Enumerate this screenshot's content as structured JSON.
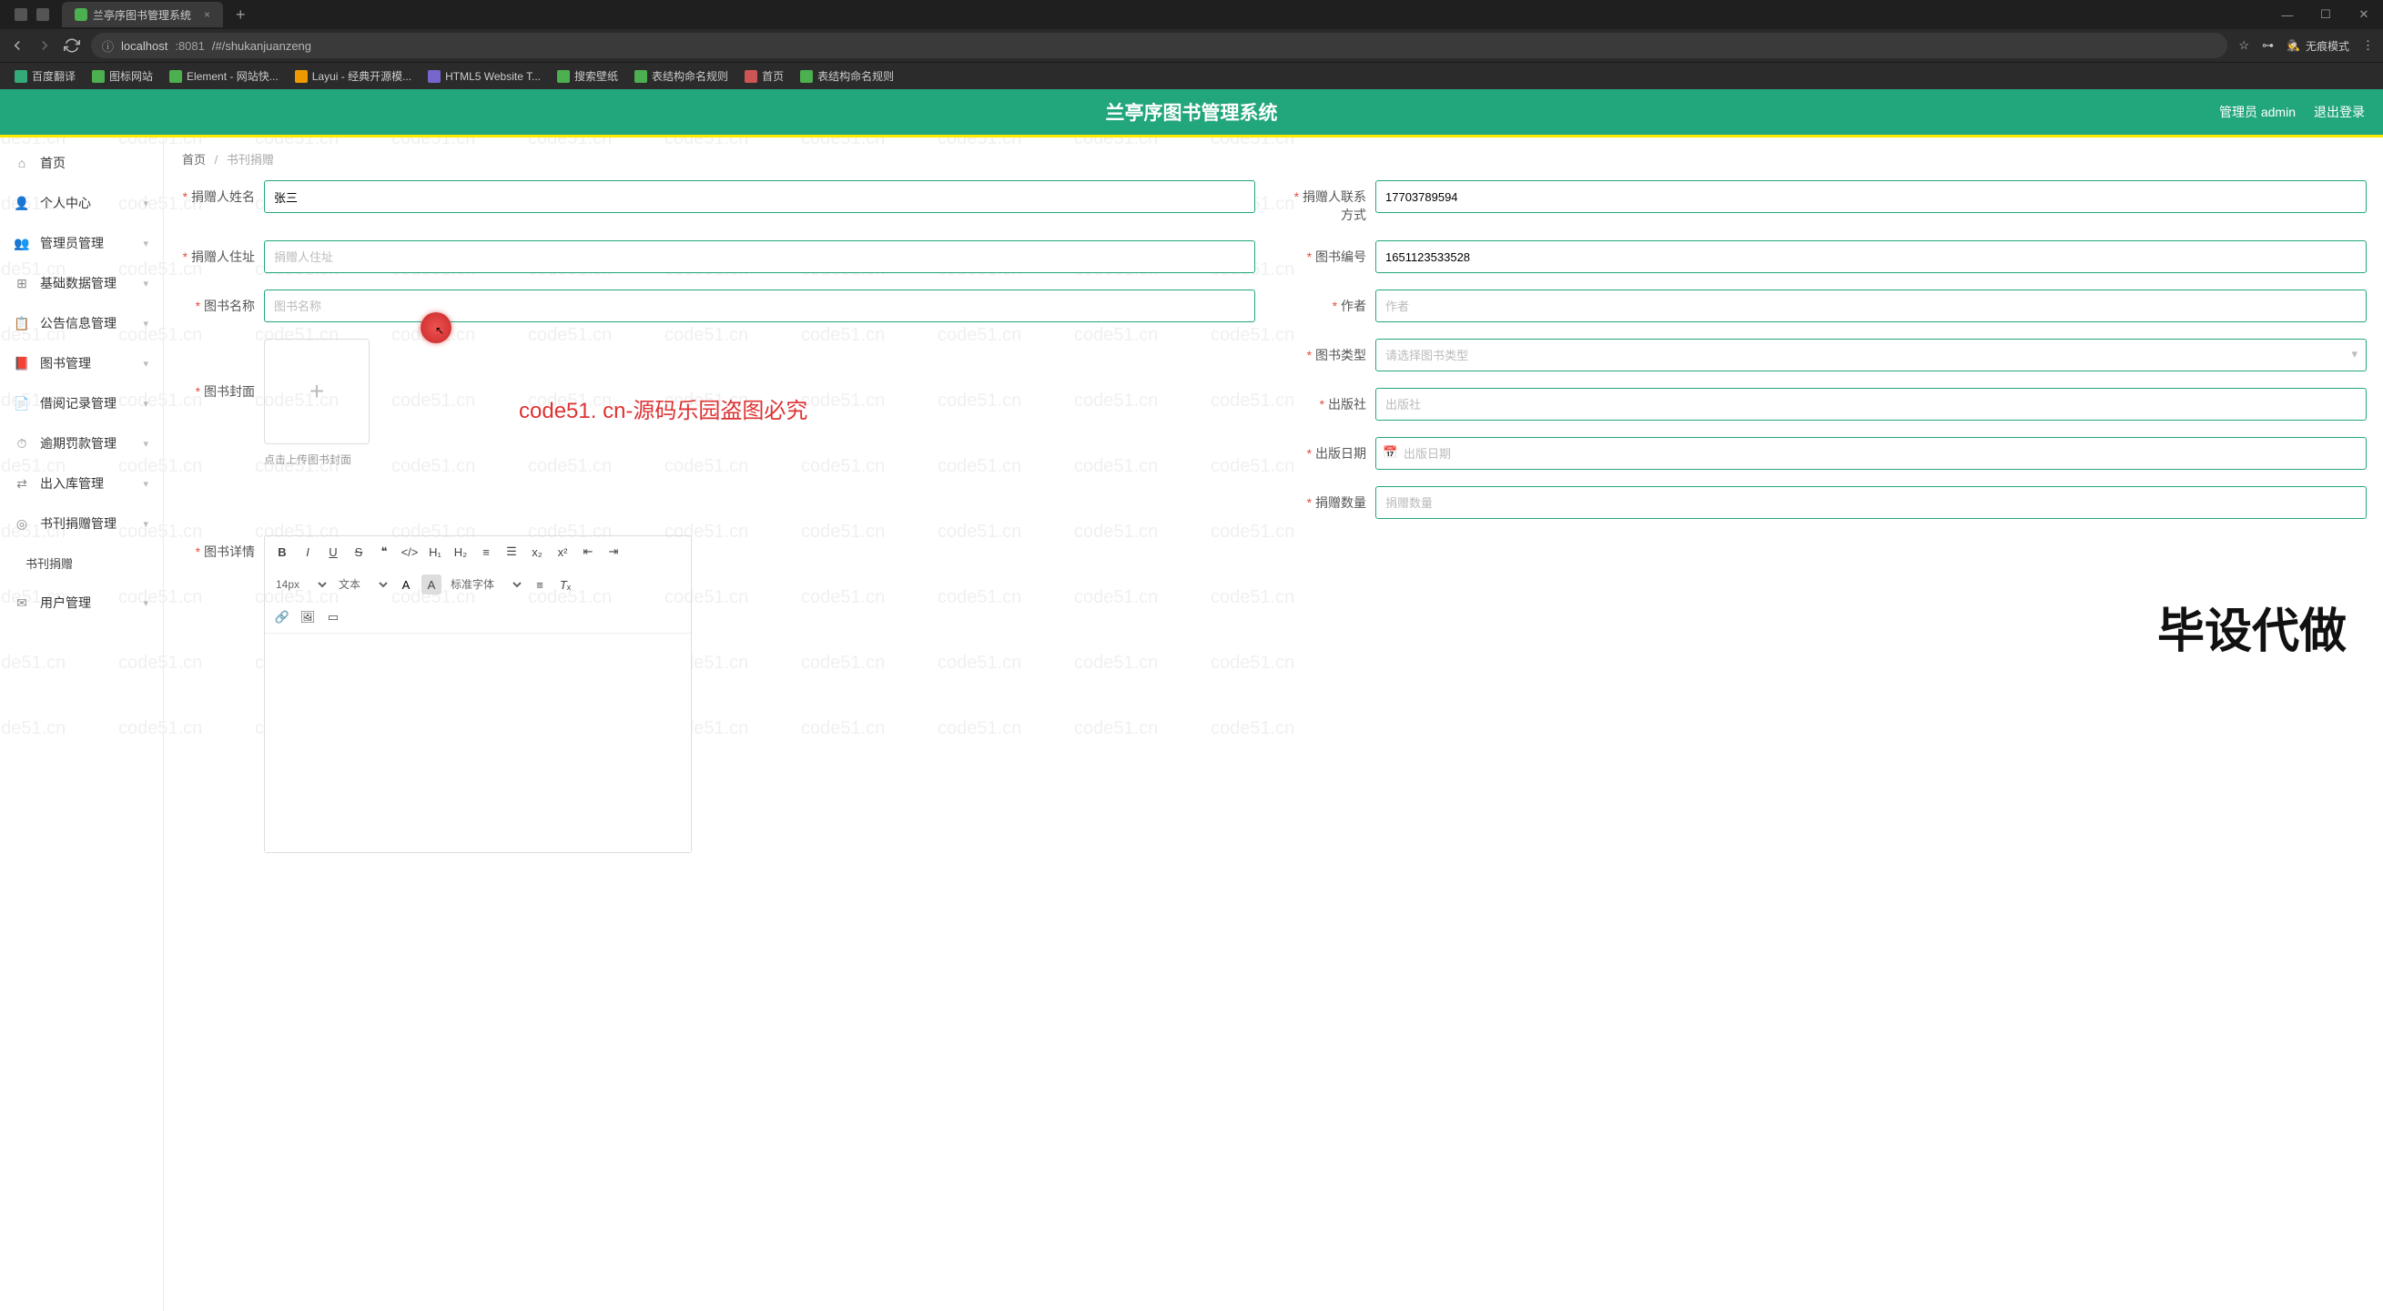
{
  "browser": {
    "tab_title": "兰亭序图书管理系统",
    "url_host": "localhost",
    "url_port": ":8081",
    "url_path": "/#/shukanjuanzeng",
    "incognito_label": "无痕模式",
    "bookmarks": [
      {
        "label": "百度翻译"
      },
      {
        "label": "图标网站"
      },
      {
        "label": "Element - 网站快..."
      },
      {
        "label": "Layui - 经典开源模..."
      },
      {
        "label": "HTML5 Website T..."
      },
      {
        "label": "搜索壁纸"
      },
      {
        "label": "表结构命名规则"
      },
      {
        "label": "首页"
      },
      {
        "label": "表结构命名规则"
      }
    ]
  },
  "app": {
    "title": "兰亭序图书管理系统",
    "user_label": "管理员 admin",
    "logout_label": "退出登录"
  },
  "sidebar": [
    {
      "label": "首页",
      "icon": "home"
    },
    {
      "label": "个人中心",
      "icon": "user",
      "expandable": true
    },
    {
      "label": "管理员管理",
      "icon": "admin",
      "expandable": true
    },
    {
      "label": "基础数据管理",
      "icon": "db",
      "expandable": true
    },
    {
      "label": "公告信息管理",
      "icon": "notice",
      "expandable": true
    },
    {
      "label": "图书管理",
      "icon": "book",
      "expandable": true
    },
    {
      "label": "借阅记录管理",
      "icon": "borrow",
      "expandable": true
    },
    {
      "label": "逾期罚款管理",
      "icon": "fine",
      "expandable": true
    },
    {
      "label": "出入库管理",
      "icon": "stock",
      "expandable": true
    },
    {
      "label": "书刊捐赠管理",
      "icon": "donate",
      "expandable": true
    },
    {
      "label": "书刊捐赠",
      "sub": true
    },
    {
      "label": "用户管理",
      "icon": "users",
      "expandable": true
    }
  ],
  "breadcrumb": {
    "home": "首页",
    "current": "书刊捐赠"
  },
  "form": {
    "donor_name": {
      "label": "捐赠人姓名",
      "value": "张三"
    },
    "donor_contact": {
      "label": "捐赠人联系方式",
      "value": "17703789594"
    },
    "donor_address": {
      "label": "捐赠人住址",
      "placeholder": "捐赠人住址"
    },
    "book_code": {
      "label": "图书编号",
      "value": "1651123533528"
    },
    "book_name": {
      "label": "图书名称",
      "placeholder": "图书名称"
    },
    "author": {
      "label": "作者",
      "placeholder": "作者"
    },
    "cover": {
      "label": "图书封面",
      "hint": "点击上传图书封面"
    },
    "book_type": {
      "label": "图书类型",
      "placeholder": "请选择图书类型"
    },
    "publisher": {
      "label": "出版社",
      "placeholder": "出版社"
    },
    "pub_date": {
      "label": "出版日期",
      "placeholder": "出版日期"
    },
    "donate_qty": {
      "label": "捐赠数量",
      "placeholder": "捐赠数量"
    },
    "detail": {
      "label": "图书详情"
    }
  },
  "editor_toolbar": {
    "font_size": "14px",
    "text_type": "文本",
    "font_family": "标准字体"
  },
  "watermark": "code51.cn",
  "overlay_text": "code51. cn-源码乐园盗图必究",
  "overlay_big": "毕设代做"
}
